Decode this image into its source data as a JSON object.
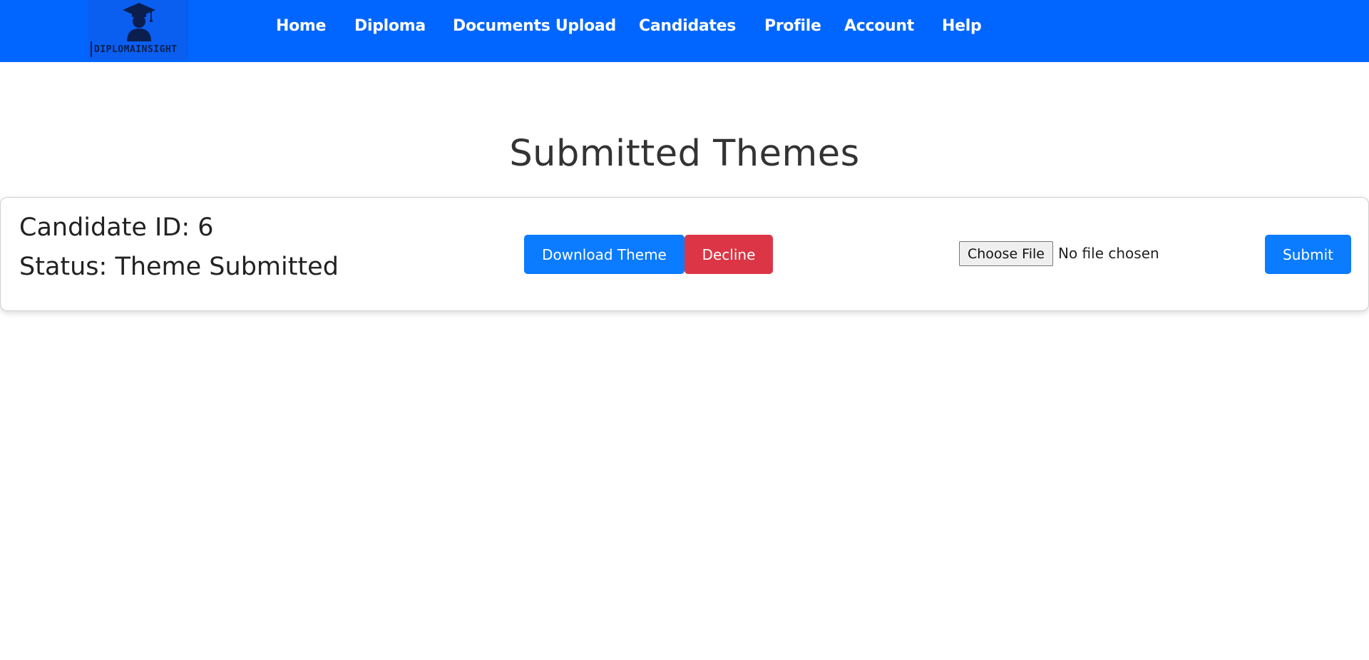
{
  "logo": {
    "text": "DIPLOMAINSIGHT",
    "icon": "graduation-cap-icon"
  },
  "nav": {
    "items": [
      {
        "label": "Home"
      },
      {
        "label": "Diploma"
      },
      {
        "label": "Documents Upload"
      },
      {
        "label": "Candidates"
      },
      {
        "label": "Profile"
      },
      {
        "label": "Account"
      },
      {
        "label": "Help"
      }
    ]
  },
  "page": {
    "title": "Submitted Themes"
  },
  "submission": {
    "candidate_line": "Candidate ID: 6",
    "status_line": "Status: Theme Submitted",
    "download_label": "Download Theme",
    "decline_label": "Decline",
    "choose_file_label": "Choose File",
    "file_status": "No file chosen",
    "submit_label": "Submit"
  },
  "colors": {
    "navbar": "#0066ff",
    "primary_button": "#0b7bff",
    "danger_button": "#dc3545"
  }
}
